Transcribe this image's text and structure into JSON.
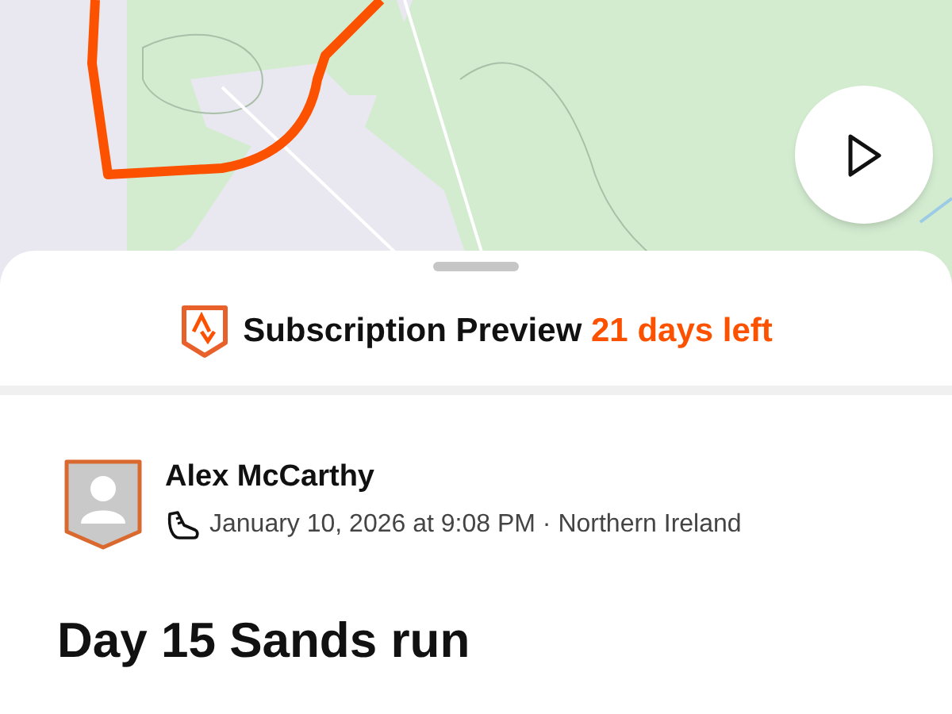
{
  "banner": {
    "title": "Subscription Preview",
    "remaining": "21 days left"
  },
  "activity": {
    "athlete": "Alex McCarthy",
    "meta": "January 10, 2026 at 9:08 PM · Northern Ireland",
    "title": "Day 15 Sands run"
  }
}
